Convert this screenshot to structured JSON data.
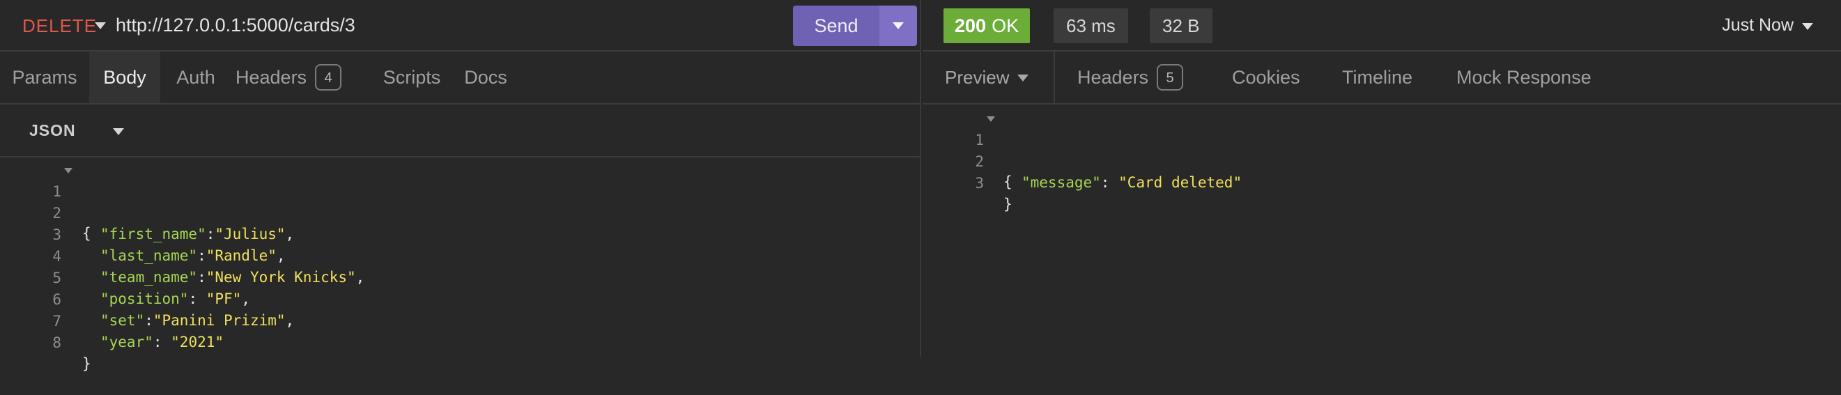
{
  "request": {
    "method": "DELETE",
    "url": "http://127.0.0.1:5000/cards/3",
    "send_label": "Send",
    "tabs": [
      {
        "label": "Params"
      },
      {
        "label": "Body"
      },
      {
        "label": "Auth"
      },
      {
        "label": "Headers",
        "badge": "4"
      },
      {
        "label": "Scripts"
      },
      {
        "label": "Docs"
      }
    ],
    "active_tab": "Body",
    "body_type": "JSON",
    "body_lines": [
      {
        "n": "1",
        "text": "{"
      },
      {
        "n": "2",
        "key": "\"first_name\"",
        "sep": ":",
        "val": "\"Julius\"",
        "end": ","
      },
      {
        "n": "3",
        "key": "\"last_name\"",
        "sep": ":",
        "val": "\"Randle\"",
        "end": ","
      },
      {
        "n": "4",
        "key": "\"team_name\"",
        "sep": ":",
        "val": "\"New York Knicks\"",
        "end": ","
      },
      {
        "n": "5",
        "key": "\"position\"",
        "sep": ": ",
        "val": "\"PF\"",
        "end": ","
      },
      {
        "n": "6",
        "key": "\"set\"",
        "sep": ":",
        "val": "\"Panini Prizim\"",
        "end": ","
      },
      {
        "n": "7",
        "key": "\"year\"",
        "sep": ": ",
        "val": "\"2021\"",
        "end": ""
      },
      {
        "n": "8",
        "text": "}"
      }
    ]
  },
  "response": {
    "status_code": "200",
    "status_text": "OK",
    "time": "63 ms",
    "size": "32 B",
    "when": "Just Now",
    "preview_label": "Preview",
    "tabs": [
      {
        "label": "Headers",
        "badge": "5"
      },
      {
        "label": "Cookies"
      },
      {
        "label": "Timeline"
      },
      {
        "label": "Mock Response"
      }
    ],
    "body_lines": [
      {
        "n": "1",
        "text": "{"
      },
      {
        "n": "2",
        "key": "\"message\"",
        "sep": ": ",
        "val": "\"Card deleted\"",
        "end": ""
      },
      {
        "n": "3",
        "text": "}"
      }
    ]
  },
  "colors": {
    "method": "#e0584b",
    "send": "#6f62b5",
    "status_ok": "#6cad3a",
    "json_key": "#a6d653",
    "json_string": "#f1e15b"
  }
}
